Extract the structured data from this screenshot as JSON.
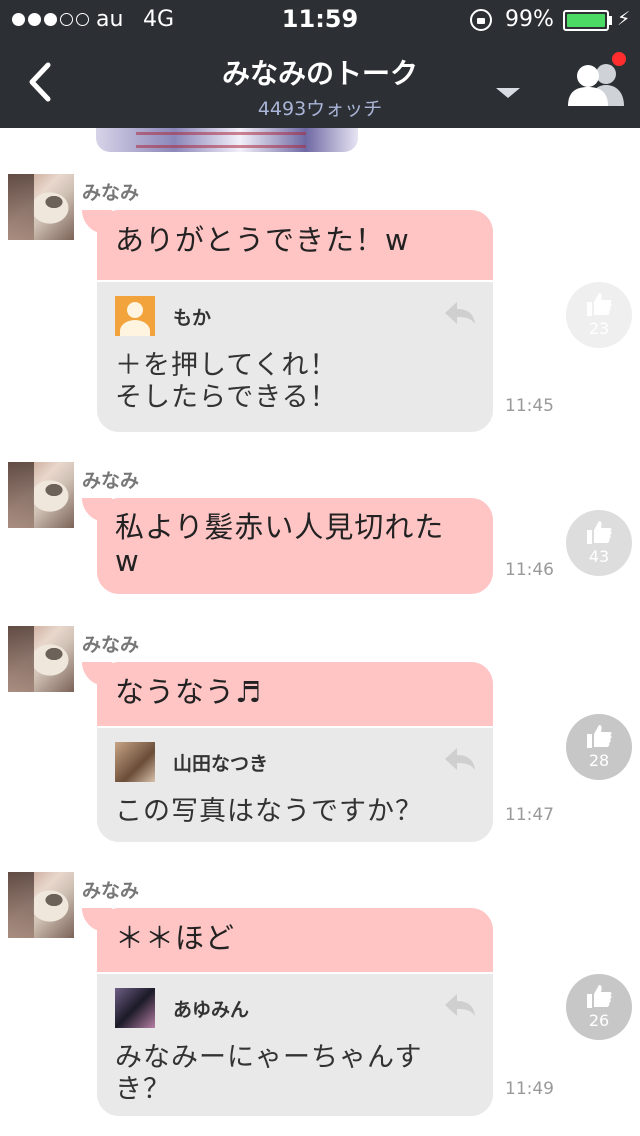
{
  "status": {
    "carrier": "au",
    "network": "4G",
    "time": "11:59",
    "battery": "99%",
    "battery_level": 0.99
  },
  "nav": {
    "title": "みなみのトーク",
    "subtitle": "4493ウォッチ"
  },
  "messages": [
    {
      "sender": "みなみ",
      "text": "ありがとうできた！w",
      "reply": {
        "name": "もか",
        "text": "＋を押してくれ！\nそしたらできる！"
      },
      "time": "11:45",
      "likes": "23"
    },
    {
      "sender": "みなみ",
      "text": "私より髪赤い人見切れた\nw",
      "time": "11:46",
      "likes": "43"
    },
    {
      "sender": "みなみ",
      "text": "なうなう♬",
      "reply": {
        "name": "山田なつき",
        "text": "この写真はなうですか？"
      },
      "time": "11:47",
      "likes": "28"
    },
    {
      "sender": "みなみ",
      "text": "＊＊ほど",
      "reply": {
        "name": "あゆみん",
        "text": "みなみーにゃーちゃんす\nき？"
      },
      "time": "11:49",
      "likes": "26"
    }
  ],
  "colors": {
    "header_bg": "#2c3035",
    "bubble_pink": "#ffc4c4",
    "reply_gray": "#e9e9e9",
    "notification": "#ff2d2d",
    "battery": "#4cd964"
  },
  "icons": [
    "back-icon",
    "dropdown-icon",
    "members-icon",
    "reply-arrow-icon",
    "thumb-icon",
    "lock-icon",
    "bolt-icon"
  ]
}
